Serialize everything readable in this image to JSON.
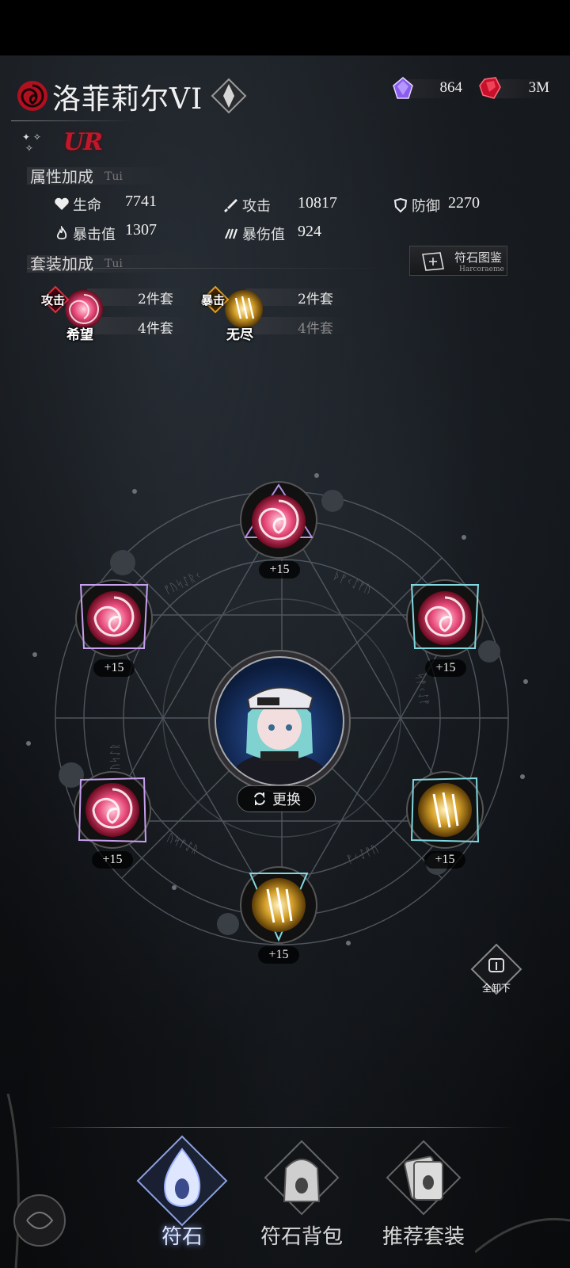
{
  "header": {
    "character_name": "洛菲莉尔VI",
    "rarity": "UR"
  },
  "currencies": [
    {
      "icon": "purple-crystal-icon",
      "value": "864"
    },
    {
      "icon": "red-gem-icon",
      "value": "3M"
    }
  ],
  "attributes": {
    "label": "属性加成",
    "sub": "Tui",
    "stats": [
      {
        "icon": "heart-icon",
        "name": "生命",
        "value": "7741"
      },
      {
        "icon": "sword-icon",
        "name": "攻击",
        "value": "10817"
      },
      {
        "icon": "shield-icon",
        "name": "防御",
        "value": "2270"
      },
      {
        "icon": "flame-icon",
        "name": "暴击值",
        "value": "1307"
      },
      {
        "icon": "claw-icon",
        "name": "暴伤值",
        "value": "924"
      }
    ]
  },
  "set_bonus": {
    "label": "套装加成",
    "sub": "Tui",
    "codex_button": {
      "label": "符石图鉴",
      "sub": "Harcoraeme"
    },
    "sets": [
      {
        "tag": "攻击",
        "name": "希望",
        "two": "2件套",
        "four": "4件套",
        "color": "#e0406a",
        "four_active": true
      },
      {
        "tag": "暴击",
        "name": "无尽",
        "two": "2件套",
        "four": "4件套",
        "color": "#d6a12a",
        "four_active": false
      }
    ]
  },
  "slots": [
    {
      "type": "hope",
      "level": "+15"
    },
    {
      "type": "hope",
      "level": "+15"
    },
    {
      "type": "hope",
      "level": "+15"
    },
    {
      "type": "hope",
      "level": "+15"
    },
    {
      "type": "endless",
      "level": "+15"
    },
    {
      "type": "endless",
      "level": "+15"
    }
  ],
  "center": {
    "change_label": "更换"
  },
  "unequip_all": {
    "label": "全卸下"
  },
  "nav": [
    {
      "label": "符石",
      "active": true
    },
    {
      "label": "符石背包",
      "active": false
    },
    {
      "label": "推荐套装",
      "active": false
    }
  ]
}
